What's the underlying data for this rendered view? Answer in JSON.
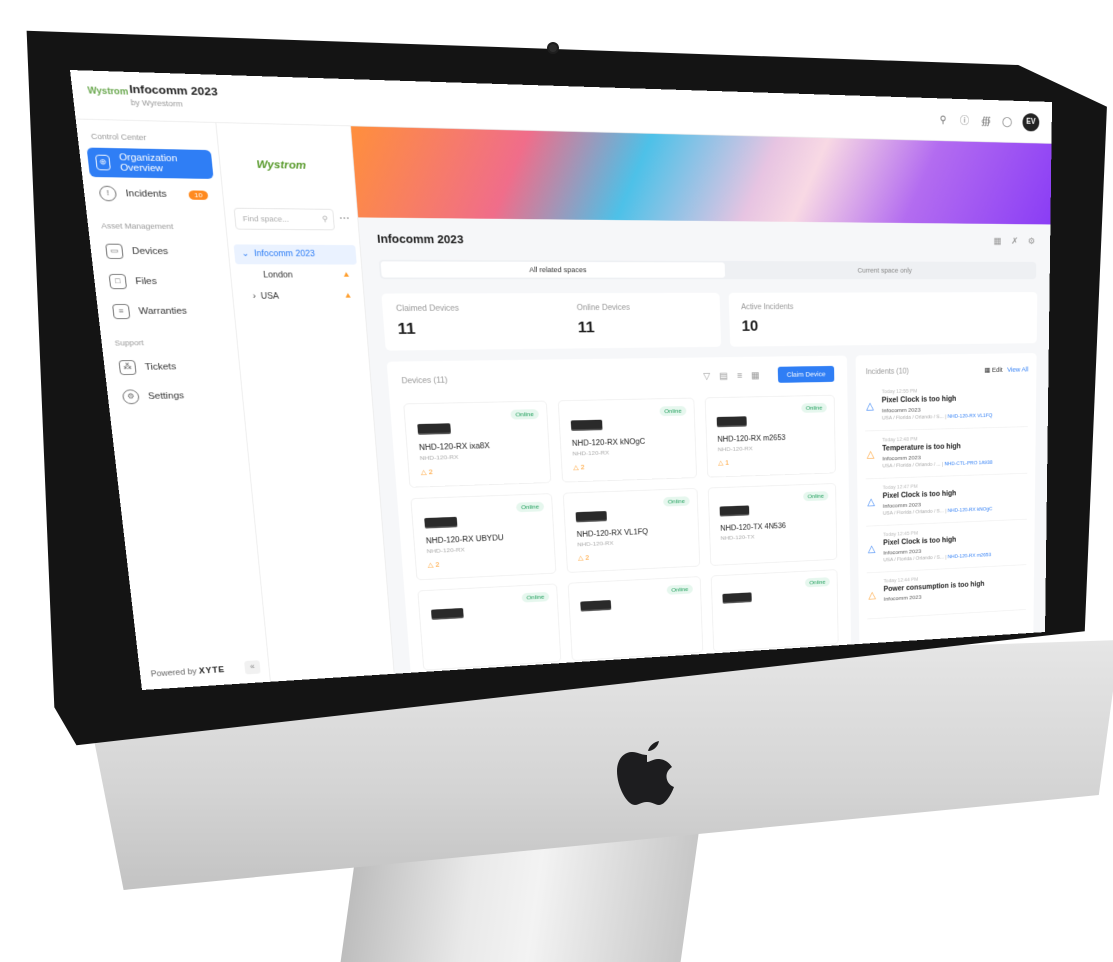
{
  "org": {
    "logo_text": "Wystrom",
    "title": "Infocomm 2023",
    "subtitle": "by Wyrestorm",
    "avatar_initials": "EV"
  },
  "sidebar": {
    "section_control": "Control Center",
    "item_overview": "Organization Overview",
    "item_incidents": "Incidents",
    "incidents_badge": "10",
    "section_assets": "Asset Management",
    "item_devices": "Devices",
    "item_files": "Files",
    "item_warranties": "Warranties",
    "section_support": "Support",
    "item_tickets": "Tickets",
    "item_settings": "Settings",
    "powered_by": "Powered by",
    "powered_brand": "XYTE"
  },
  "spaces": {
    "logo_text": "Wystrom",
    "search_placeholder": "Find space...",
    "tree": [
      {
        "label": "Infocomm 2023"
      },
      {
        "label": "London"
      },
      {
        "label": "USA"
      }
    ]
  },
  "main": {
    "page_title": "Infocomm 2023",
    "seg_all": "All related spaces",
    "seg_current": "Current space only",
    "stats": [
      {
        "label": "Claimed Devices",
        "value": "11"
      },
      {
        "label": "Online Devices",
        "value": "11"
      },
      {
        "label": "Active Incidents",
        "value": "10"
      }
    ],
    "devices_title": "Devices (11)",
    "claim_button": "Claim Device",
    "online_label": "Online",
    "devices": [
      {
        "name": "NHD-120-RX ixa8X",
        "model": "NHD-120-RX",
        "warn": "2"
      },
      {
        "name": "NHD-120-RX kNOgC",
        "model": "NHD-120-RX",
        "warn": "2"
      },
      {
        "name": "NHD-120-RX m2653",
        "model": "NHD-120-RX",
        "warn": "1"
      },
      {
        "name": "NHD-120-RX UBYDU",
        "model": "NHD-120-RX",
        "warn": "2"
      },
      {
        "name": "NHD-120-RX VL1FQ",
        "model": "NHD-120-RX",
        "warn": "2"
      },
      {
        "name": "NHD-120-TX 4N536",
        "model": "NHD-120-TX",
        "warn": ""
      }
    ],
    "incidents_title": "Incidents (10)",
    "incidents_edit": "Edit",
    "incidents_view_all": "View All",
    "incidents": [
      {
        "time": "Today 12:55 PM",
        "title": "Pixel Clock is too high",
        "space": "Infocomm 2023",
        "path": "USA / Florida / Orlando / S...",
        "device": "NHD-120-RX VL1FQ",
        "level": "info"
      },
      {
        "time": "Today 12:48 PM",
        "title": "Temperature is too high",
        "space": "Infocomm 2023",
        "path": "USA / Florida / Orlando / ...",
        "device": "NHD-CTL-PRO 1A938",
        "level": "warn"
      },
      {
        "time": "Today 12:47 PM",
        "title": "Pixel Clock is too high",
        "space": "Infocomm 2023",
        "path": "USA / Florida / Orlando / S...",
        "device": "NHD-120-RX kNOgC",
        "level": "info"
      },
      {
        "time": "Today 12:45 PM",
        "title": "Pixel Clock is too high",
        "space": "Infocomm 2023",
        "path": "USA / Florida / Orlando / S...",
        "device": "NHD-120-RX m2653",
        "level": "info"
      },
      {
        "time": "Today 12:44 PM",
        "title": "Power consumption is too high",
        "space": "Infocomm 2023",
        "path": "",
        "device": "",
        "level": "warn"
      }
    ]
  }
}
